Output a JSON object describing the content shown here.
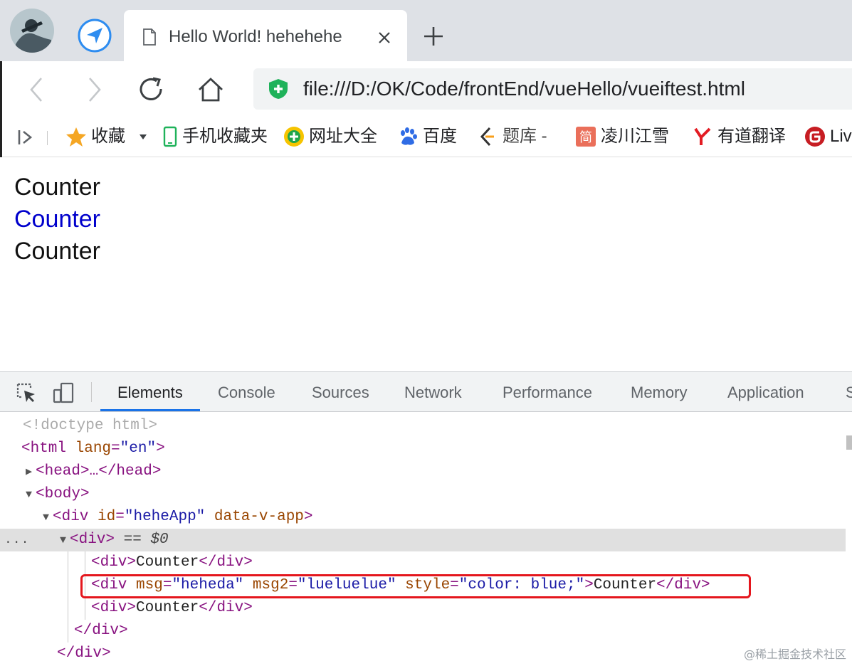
{
  "browser": {
    "tab": {
      "title": "Hello World! hehehehe"
    },
    "url": "file:///D:/OK/Code/frontEnd/vueHello/vueiftest.html",
    "bookmarks": [
      {
        "label": "收藏",
        "icon": "star-icon"
      },
      {
        "label": "手机收藏夹",
        "icon": "phone-icon"
      },
      {
        "label": "网址大全",
        "icon": "globe-plus-icon"
      },
      {
        "label": "百度",
        "icon": "baidu-paw-icon"
      },
      {
        "label": "题库 -",
        "icon": "leetcode-icon"
      },
      {
        "label": "凌川江雪",
        "icon": "jianshu-icon"
      },
      {
        "label": "有道翻译",
        "icon": "youdao-icon"
      },
      {
        "label": "Liv",
        "icon": "gitee-icon"
      }
    ]
  },
  "page": {
    "lines": [
      "Counter",
      "Counter",
      "Counter"
    ],
    "colors": {
      "normal": "#111111",
      "blue": "#0000cc"
    }
  },
  "devtools": {
    "tabs": [
      "Elements",
      "Console",
      "Sources",
      "Network",
      "Performance",
      "Memory",
      "Application",
      "S"
    ],
    "active_tab": "Elements",
    "dom": {
      "doctype": "<!doctype html>",
      "html_open": {
        "tag_open": "<html",
        "attr": "lang",
        "eq": "=",
        "val": "\"en\"",
        "close": ">"
      },
      "head": {
        "text": "<head>…</head>"
      },
      "body_open": "<body>",
      "app_div": {
        "tag_open": "<div",
        "attr1": "id",
        "eq": "=",
        "val1": "\"heheApp\"",
        "attr2": "data-v-app",
        "close": ">"
      },
      "inner_div": {
        "tag": "<div>",
        "marker": "== $0",
        "ellipsis": "..."
      },
      "child1": {
        "open": "<div>",
        "text": "Counter",
        "close": "</div>"
      },
      "child2": {
        "open": "<div",
        "attr1": "msg",
        "eq": "=",
        "val1": "\"heheda\"",
        "attr2": "msg2",
        "val2": "\"lueluelue\"",
        "attr3": "style",
        "val3": "\"color: blue;\"",
        "gt": ">",
        "text": "Counter",
        "close": "</div>"
      },
      "child3": {
        "open": "<div>",
        "text": "Counter",
        "close": "</div>"
      },
      "inner_close": "</div>",
      "app_close": "</div>"
    }
  },
  "watermark": "@稀土掘金技术社区",
  "accent_colors": {
    "devtools_active": "#1a73e8",
    "highlight_border": "#e4161d",
    "secure_shield": "#1fb25a"
  }
}
